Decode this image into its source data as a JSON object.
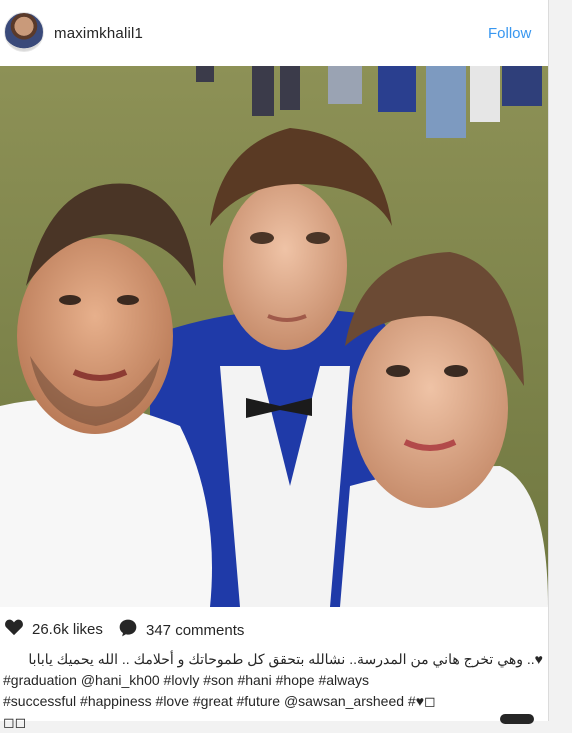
{
  "post": {
    "username": "maximkhalil1",
    "follow_label": "Follow",
    "likes": "26.6k likes",
    "comments": "347 comments",
    "caption_lines": [
      "♥.. وهي تخرج هاني من المدرسة.. نشالله بتحقق كل طموحاتك و أحلامك .. الله يحميك يابابا",
      "#graduation @hani_kh00 #lovly #son #hani #hope #always",
      "#successful #happiness #love #great #future @sawsan_arsheed #♥◻",
      "◻◻"
    ]
  },
  "icons": {
    "like": "heart-icon",
    "comment": "comment-bubble-icon"
  },
  "colors": {
    "accent": "#3897f0",
    "text": "#262626",
    "gown": "#1f3aa8"
  }
}
